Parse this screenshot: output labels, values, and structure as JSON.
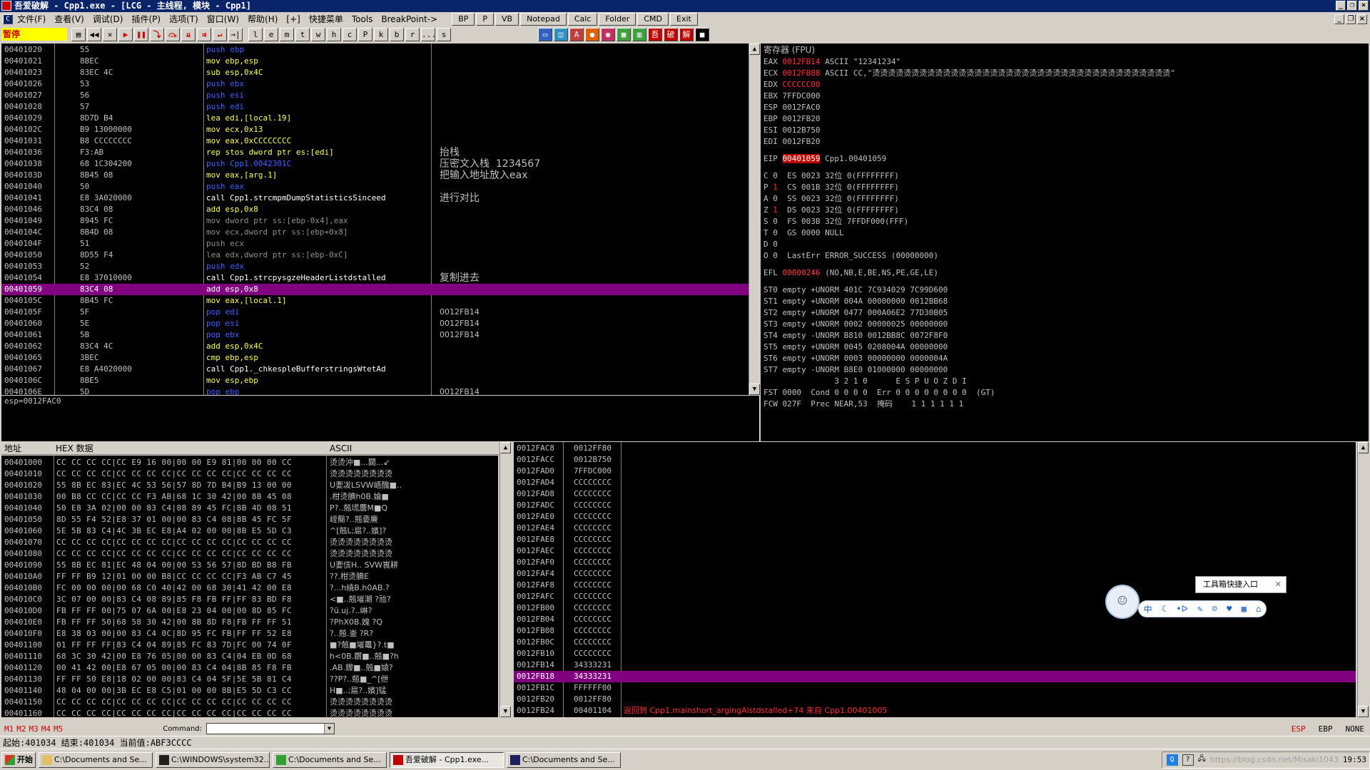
{
  "window": {
    "title": "吾爱破解 - Cpp1.exe - [LCG - 主线程, 模块 - Cpp1]"
  },
  "menu": {
    "items": [
      "文件(F)",
      "查看(V)",
      "调试(D)",
      "插件(P)",
      "选项(T)",
      "窗口(W)",
      "帮助(H)",
      "[+]",
      "快捷菜单",
      "Tools",
      "BreakPoint->"
    ],
    "quick_buttons": [
      "BP",
      "P",
      "VB",
      "Notepad",
      "Calc",
      "Folder",
      "CMD",
      "Exit"
    ]
  },
  "toolbar": {
    "status": "暂停",
    "letters": [
      "l",
      "e",
      "m",
      "t",
      "w",
      "h",
      "c",
      "P",
      "k",
      "b",
      "r",
      "...",
      "s"
    ]
  },
  "disasm": {
    "rows": [
      {
        "addr": "00401020",
        "hex": "55",
        "asm": "push ebp",
        "cls": "hl-cyan",
        "comment": ""
      },
      {
        "addr": "00401021",
        "hex": "8BEC",
        "asm": "mov ebp,esp",
        "cls": "",
        "comment": ""
      },
      {
        "addr": "00401023",
        "hex": "83EC 4C",
        "asm": "sub esp,0x4C",
        "cls": "",
        "comment": ""
      },
      {
        "addr": "00401026",
        "hex": "53",
        "asm": "push ebx",
        "cls": "hl-cyan",
        "comment": ""
      },
      {
        "addr": "00401027",
        "hex": "56",
        "asm": "push esi",
        "cls": "hl-cyan",
        "comment": ""
      },
      {
        "addr": "00401028",
        "hex": "57",
        "asm": "push edi",
        "cls": "hl-cyan",
        "comment": ""
      },
      {
        "addr": "00401029",
        "hex": "8D7D B4",
        "asm": "lea edi,[local.19]",
        "cls": "",
        "comment": ""
      },
      {
        "addr": "0040102C",
        "hex": "B9 13000000",
        "asm": "mov ecx,0x13",
        "cls": "",
        "comment": ""
      },
      {
        "addr": "00401031",
        "hex": "B8 CCCCCCCC",
        "asm": "mov eax,0xCCCCCCCC",
        "cls": "",
        "comment": ""
      },
      {
        "addr": "00401036",
        "hex": "F3:AB",
        "asm": "rep stos dword ptr es:[edi]",
        "cls": "",
        "comment": "抬栈"
      },
      {
        "addr": "00401038",
        "hex": "68 1C304200",
        "asm": "push Cpp1.0042301C",
        "cls": "hl-cyan",
        "comment": "压密文入栈  1234567"
      },
      {
        "addr": "0040103D",
        "hex": "8B45 08",
        "asm": "mov eax,[arg.1]",
        "cls": "",
        "comment": "把输入地址放入eax"
      },
      {
        "addr": "00401040",
        "hex": "50",
        "asm": "push eax",
        "cls": "hl-cyan",
        "comment": ""
      },
      {
        "addr": "00401041",
        "hex": "E8 3A020000",
        "asm": "call Cpp1.strcmpmDumpStatisticsSinceed",
        "cls": "hl-call",
        "comment": "进行对比"
      },
      {
        "addr": "00401046",
        "hex": "83C4 08",
        "asm": "add esp,0x8",
        "cls": "",
        "comment": ""
      },
      {
        "addr": "00401049",
        "hex": "8945 FC",
        "asm": "mov dword ptr ss:[ebp-0x4],eax",
        "cls": "gray",
        "comment": ""
      },
      {
        "addr": "0040104C",
        "hex": "8B4D 08",
        "asm": "mov ecx,dword ptr ss:[ebp+0x8]",
        "cls": "gray",
        "comment": ""
      },
      {
        "addr": "0040104F",
        "hex": "51",
        "asm": "push ecx",
        "cls": "gray",
        "comment": ""
      },
      {
        "addr": "00401050",
        "hex": "8D55 F4",
        "asm": "lea edx,dword ptr ss:[ebp-0xC]",
        "cls": "gray",
        "comment": ""
      },
      {
        "addr": "00401053",
        "hex": "52",
        "asm": "push edx",
        "cls": "hl-cyan",
        "comment": ""
      },
      {
        "addr": "00401054",
        "hex": "E8 37010000",
        "asm": "call Cpp1.strcpysgzeHeaderListdstalled",
        "cls": "hl-call",
        "comment": "复制进去"
      },
      {
        "addr": "00401059",
        "hex": "83C4 08",
        "asm": "add esp,0x8",
        "cls": "sel",
        "comment": ""
      },
      {
        "addr": "0040105C",
        "hex": "8B45 FC",
        "asm": "mov eax,[local.1]",
        "cls": "",
        "comment": ""
      },
      {
        "addr": "0040105F",
        "hex": "5F",
        "asm": "pop edi",
        "cls": "hl-cyan",
        "comment": "0012FB14"
      },
      {
        "addr": "00401060",
        "hex": "5E",
        "asm": "pop esi",
        "cls": "hl-cyan",
        "comment": "0012FB14"
      },
      {
        "addr": "00401061",
        "hex": "5B",
        "asm": "pop ebx",
        "cls": "hl-cyan",
        "comment": "0012FB14"
      },
      {
        "addr": "00401062",
        "hex": "83C4 4C",
        "asm": "add esp,0x4C",
        "cls": "",
        "comment": ""
      },
      {
        "addr": "00401065",
        "hex": "3BEC",
        "asm": "cmp ebp,esp",
        "cls": "",
        "comment": ""
      },
      {
        "addr": "00401067",
        "hex": "E8 A4020000",
        "asm": "call Cpp1._chkespleBufferstringsWtetAd",
        "cls": "hl-call",
        "comment": ""
      },
      {
        "addr": "0040106C",
        "hex": "8BE5",
        "asm": "mov esp,ebp",
        "cls": "",
        "comment": ""
      },
      {
        "addr": "0040106E",
        "hex": "5D",
        "asm": "pop ebp",
        "cls": "hl-cyan",
        "comment": "0012FB14"
      }
    ],
    "info": "esp=0012FAC0"
  },
  "registers": {
    "title": "寄存器 (FPU)",
    "rows": [
      {
        "name": "EAX",
        "val": "0012FB14",
        "rest": "ASCII \"12341234\"",
        "changed": true
      },
      {
        "name": "ECX",
        "val": "0012FB88",
        "rest": "ASCII CC,\"烫烫烫烫烫烫烫烫烫烫烫烫烫烫烫烫烫烫烫烫烫烫烫烫烫烫烫烫烫烫烫烫烫烫烫烫烫烫\"",
        "changed": true
      },
      {
        "name": "EDX",
        "val": "CCCCCC00",
        "rest": "",
        "changed": true
      },
      {
        "name": "EBX",
        "val": "7FFDC000",
        "rest": "",
        "changed": false
      },
      {
        "name": "ESP",
        "val": "0012FAC0",
        "rest": "",
        "changed": false
      },
      {
        "name": "EBP",
        "val": "0012FB20",
        "rest": "",
        "changed": false
      },
      {
        "name": "ESI",
        "val": "0012B750",
        "rest": "",
        "changed": false
      },
      {
        "name": "EDI",
        "val": "0012FB20",
        "rest": "",
        "changed": false
      }
    ],
    "eip": {
      "name": "EIP",
      "val": "00401059",
      "rest": "Cpp1.00401059"
    },
    "flags": [
      {
        "f": "C",
        "v": "0",
        "rest": "ES 0023 32位 0(FFFFFFFF)",
        "red": false
      },
      {
        "f": "P",
        "v": "1",
        "rest": "CS 001B 32位 0(FFFFFFFF)",
        "red": true
      },
      {
        "f": "A",
        "v": "0",
        "rest": "SS 0023 32位 0(FFFFFFFF)",
        "red": false
      },
      {
        "f": "Z",
        "v": "1",
        "rest": "DS 0023 32位 0(FFFFFFFF)",
        "red": true
      },
      {
        "f": "S",
        "v": "0",
        "rest": "FS 003B 32位 7FFDF000(FFF)",
        "red": false
      },
      {
        "f": "T",
        "v": "0",
        "rest": "GS 0000 NULL",
        "red": false
      },
      {
        "f": "D",
        "v": "0",
        "rest": "",
        "red": false
      },
      {
        "f": "O",
        "v": "0",
        "rest": "LastErr ERROR_SUCCESS (00000000)",
        "red": false
      }
    ],
    "efl": {
      "name": "EFL",
      "val": "00000246",
      "rest": "(NO,NB,E,BE,NS,PE,GE,LE)"
    },
    "fpu": [
      "ST0 empty +UNORM 401C 7C934029 7C99D600",
      "ST1 empty +UNORM 004A 00000000 0012BB68",
      "ST2 empty +UNORM 0477 000A06E2 77D30B05",
      "ST3 empty +UNORM 0002 00000025 00000000",
      "ST4 empty -UNORM B810 0012BB8C 0072F8F0",
      "ST5 empty +UNORM 0045 0208004A 00000000",
      "ST6 empty +UNORM 0003 00000000 0000004A",
      "ST7 empty -UNORM B8E0 01000000 00000000",
      "               3 2 1 0      E S P U O Z D I",
      "FST 0000  Cond 0 0 0 0  Err 0 0 0 0 0 0 0 0  (GT)",
      "FCW 027F  Prec NEAR,53  掩码    1 1 1 1 1 1"
    ]
  },
  "dump": {
    "headers": [
      "地址",
      "HEX 数据",
      "ASCII"
    ],
    "rows": [
      {
        "a": "00401000",
        "h": "CC CC CC CC|CC E9 16 00|00 00 E9 81|00 00 00 CC",
        "s": "烫烫沖■...閮...↙"
      },
      {
        "a": "00401010",
        "h": "CC CC CC CC|CC CC CC CC|CC CC CC CC|CC CC CC CC",
        "s": "烫烫烫烫烫烫烫烫"
      },
      {
        "a": "00401020",
        "h": "55 8B EC 83|EC 4C 53 56|57 8D 7D B4|B9 13 00 00",
        "s": "U嬱冹LSVW峿醜■.."
      },
      {
        "a": "00401030",
        "h": "00 B8 CC CC|CC CC F3 AB|68 1C 30 42|00 8B 45 08",
        "s": ".柑烫腆h0B.婨■"
      },
      {
        "a": "00401040",
        "h": "50 E8 3A 02|00 00 83 C4|08 89 45 FC|8B 4D 08 51",
        "s": "P?..兡塃麐M■Q"
      },
      {
        "a": "00401050",
        "h": "8D 55 F4 52|E8 37 01 00|00 83 C4 08|8B 45 FC 5F",
        "s": "峌鬜?..兡嬊麍"
      },
      {
        "a": "00401060",
        "h": "5E 5B 83 C4|4C 3B EC E8|A4 02 00 00|8B E5 5D C3",
        "s": "^[兡L;扈?..嬪]?"
      },
      {
        "a": "00401070",
        "h": "CC CC CC CC|CC CC CC CC|CC CC CC CC|CC CC CC CC",
        "s": "烫烫烫烫烫烫烫烫"
      },
      {
        "a": "00401080",
        "h": "CC CC CC CC|CC CC CC CC|CC CC CC CC|CC CC CC CC",
        "s": "烫烫烫烫烫烫烫烫"
      },
      {
        "a": "00401090",
        "h": "55 8B EC 81|EC 48 04 00|00 53 56 57|8D BD B8 FB",
        "s": "U嬱侅H.. SVW嵔耕"
      },
      {
        "a": "004010A0",
        "h": "FF FF B9 12|01 00 00 B8|CC CC CC CC|F3 AB C7 45",
        "s": "??.柑烫腆E"
      },
      {
        "a": "004010B0",
        "h": "FC 00 00 00|00 68 C0 40|42 00 68 30|41 42 00 E8",
        "s": "?...h繞B.h0AB.?"
      },
      {
        "a": "004010C0",
        "h": "3C 07 00 00|83 C4 08 89|85 F8 FB FF|FF 83 BD F8",
        "s": "<■..兡墔潮 ?兘?"
      },
      {
        "a": "004010D0",
        "h": "FB FF FF 00|75 07 6A 00|E8 23 04 00|00 8D 85 FC",
        "s": "?ü.uj.?..崊?"
      },
      {
        "a": "004010E0",
        "h": "FB FF FF 50|68 58 30 42|00 8B 8D F8|FB FF FF 51",
        "s": "?PhX0B.媿 ?Q"
      },
      {
        "a": "004010F0",
        "h": "E8 38 03 00|00 83 C4 0C|8D 95 FC FB|FF FF 52 E8",
        "s": "?..兡.崟 ?R?"
      },
      {
        "a": "00401100",
        "h": "01 FF FF FF|83 C4 04 89|85 FC 83 7D|FC 00 74 0F",
        "s": "■?兡■墔鼉}?.t■"
      },
      {
        "a": "00401110",
        "h": "68 3C 30 42|00 E8 76 05|00 00 83 C4|04 EB 0D 68",
        "s": "h<0B.鑦■..兡■?h"
      },
      {
        "a": "00401120",
        "h": "00 41 42 00|E8 67 05 00|00 83 C4 04|8B 85 F8 FB",
        "s": ".AB.鑗■..兡■媴?"
      },
      {
        "a": "00401130",
        "h": "FF FF 50 E8|18 02 00 00|83 C4 04 5F|5E 5B 81 C4",
        "s": "??P?..兡■_^[伳"
      },
      {
        "a": "00401140",
        "h": "48 04 00 00|3B EC E8 C5|01 00 00 8B|E5 5D C3 CC",
        "s": "H■..;扈?..嬪]锰"
      },
      {
        "a": "00401150",
        "h": "CC CC CC CC|CC CC CC CC|CC CC CC CC|CC CC CC CC",
        "s": "烫烫烫烫烫烫烫烫"
      },
      {
        "a": "00401160",
        "h": "CC CC CC CC|CC CC CC CC|CC CC CC CC|CC CC CC CC",
        "s": "烫烫烫烫烫烫烫烫"
      }
    ]
  },
  "stack": {
    "rows": [
      {
        "a": "0012FAC8",
        "v": "0012FF80",
        "c": ""
      },
      {
        "a": "0012FACC",
        "v": "0012B750",
        "c": ""
      },
      {
        "a": "0012FAD0",
        "v": "7FFDC000",
        "c": ""
      },
      {
        "a": "0012FAD4",
        "v": "CCCCCCCC",
        "c": ""
      },
      {
        "a": "0012FAD8",
        "v": "CCCCCCCC",
        "c": ""
      },
      {
        "a": "0012FADC",
        "v": "CCCCCCCC",
        "c": ""
      },
      {
        "a": "0012FAE0",
        "v": "CCCCCCCC",
        "c": ""
      },
      {
        "a": "0012FAE4",
        "v": "CCCCCCCC",
        "c": ""
      },
      {
        "a": "0012FAE8",
        "v": "CCCCCCCC",
        "c": ""
      },
      {
        "a": "0012FAEC",
        "v": "CCCCCCCC",
        "c": ""
      },
      {
        "a": "0012FAF0",
        "v": "CCCCCCCC",
        "c": ""
      },
      {
        "a": "0012FAF4",
        "v": "CCCCCCCC",
        "c": ""
      },
      {
        "a": "0012FAF8",
        "v": "CCCCCCCC",
        "c": ""
      },
      {
        "a": "0012FAFC",
        "v": "CCCCCCCC",
        "c": ""
      },
      {
        "a": "0012FB00",
        "v": "CCCCCCCC",
        "c": ""
      },
      {
        "a": "0012FB04",
        "v": "CCCCCCCC",
        "c": ""
      },
      {
        "a": "0012FB08",
        "v": "CCCCCCCC",
        "c": ""
      },
      {
        "a": "0012FB0C",
        "v": "CCCCCCCC",
        "c": ""
      },
      {
        "a": "0012FB10",
        "v": "CCCCCCCC",
        "c": ""
      },
      {
        "a": "0012FB14",
        "v": "34333231",
        "c": ""
      },
      {
        "a": "0012FB18",
        "v": "34333231",
        "c": "",
        "sel": true
      },
      {
        "a": "0012FB1C",
        "v": "FFFFFF00",
        "c": ""
      },
      {
        "a": "0012FB20",
        "v": "0012FF80",
        "c": ""
      },
      {
        "a": "0012FB24",
        "v": "00401104",
        "c": "返回到 Cpp1.mainshort_argingAistdstalled+74 来自 Cpp1.00401005"
      }
    ]
  },
  "cmdbar": {
    "tabs": [
      "M1",
      "M2",
      "M3",
      "M4",
      "M5"
    ],
    "command_label": "Command:",
    "command_value": "",
    "right": [
      "ESP",
      "EBP",
      "NONE"
    ]
  },
  "status": {
    "text": "起始:401034 结束:401034 当前值:ABF3CCCC"
  },
  "floatbar": {
    "tooltip": "工具箱快捷入口",
    "icons": [
      "中",
      "☾",
      "•ᐅ",
      "✎",
      "☺",
      "♥",
      "▦",
      "⌂"
    ]
  },
  "taskbar": {
    "start": "开始",
    "tasks": [
      "C:\\Documents and Se...",
      "C:\\WINDOWS\\system32...",
      "C:\\Documents and Se...",
      "吾爱破解 - Cpp1.exe...",
      "C:\\Documents and Se..."
    ],
    "watermark": "https://blog.csdn.net/Misaki1043",
    "clock": "19:53"
  }
}
